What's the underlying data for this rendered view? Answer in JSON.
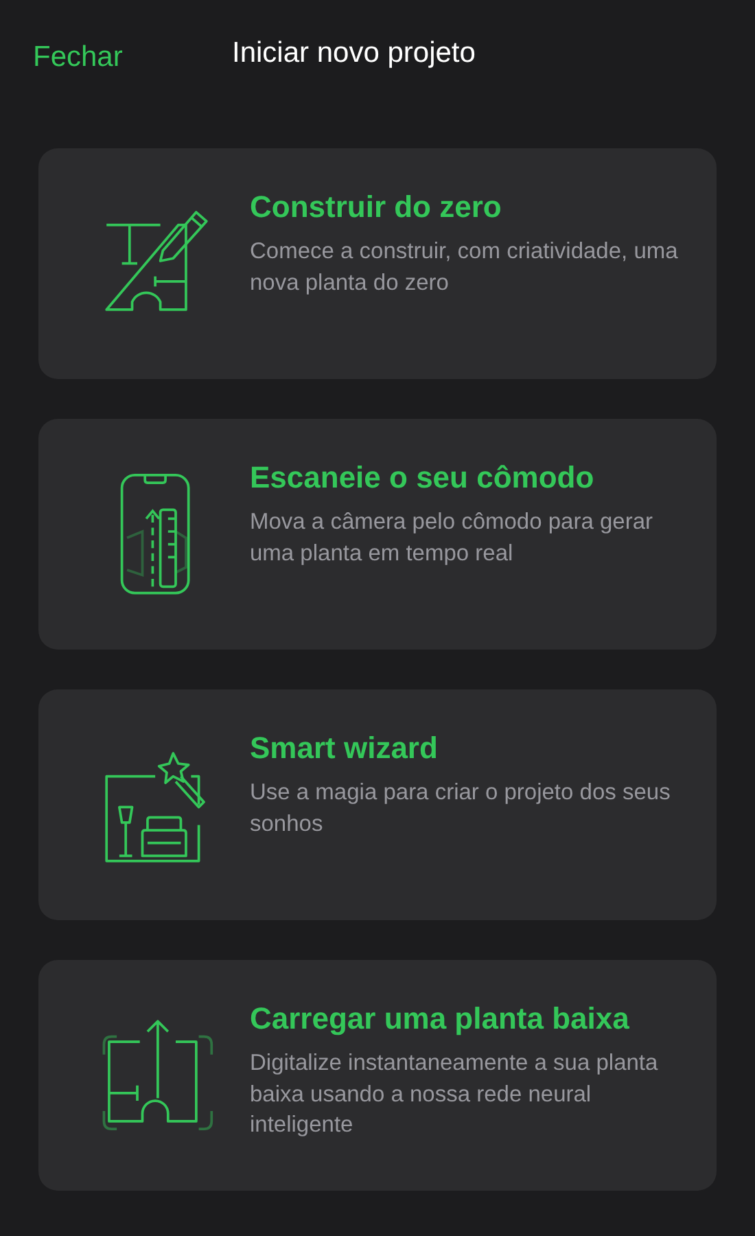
{
  "header": {
    "close": "Fechar",
    "title": "Iniciar novo projeto"
  },
  "options": [
    {
      "kind": "draw",
      "title": "Construir do zero",
      "description": "Comece a construir, com criatividade, uma nova planta do zero"
    },
    {
      "kind": "scan",
      "title": "Escaneie o seu cômodo",
      "description": "Mova a câmera pelo cômodo para gerar uma planta em tempo real"
    },
    {
      "kind": "wizard",
      "title": "Smart wizard",
      "description": "Use a magia para criar o projeto dos seus sonhos"
    },
    {
      "kind": "upload",
      "title": "Carregar uma planta baixa",
      "description": "Digitalize instantaneamente a sua planta baixa usando a nossa rede neural inteligente"
    }
  ]
}
